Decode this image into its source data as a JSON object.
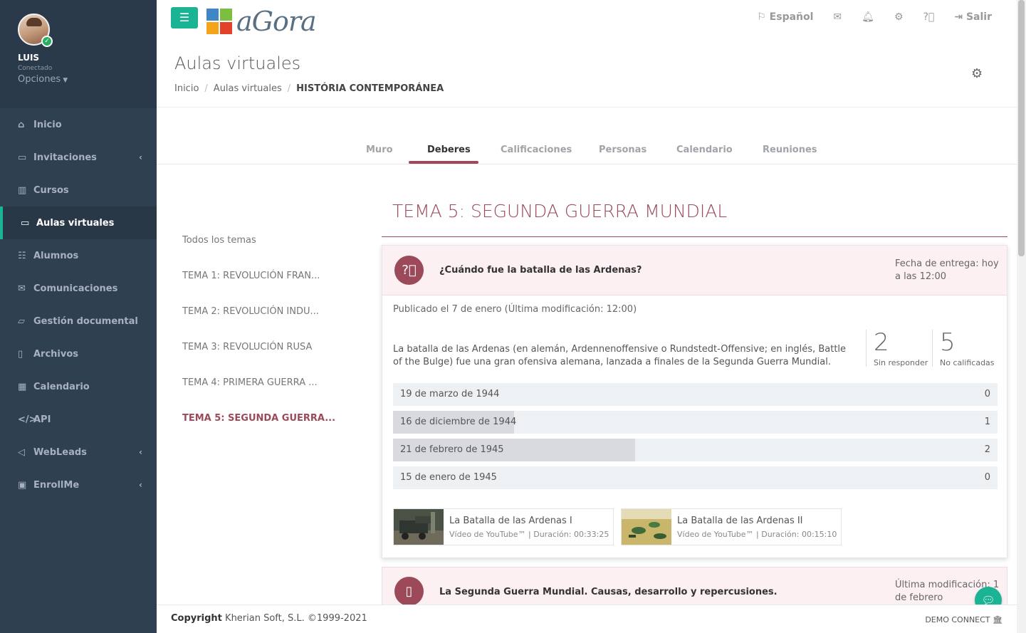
{
  "sidebar": {
    "user": {
      "name": "LUIS",
      "status": "Conectado",
      "options_label": "Opciones"
    },
    "items": [
      {
        "label": "Inicio",
        "icon": "home-icon",
        "glyph": "⌂",
        "has_arrow": false,
        "active": false
      },
      {
        "label": "Invitaciones",
        "icon": "ticket-icon",
        "glyph": "▭",
        "has_arrow": true,
        "active": false
      },
      {
        "label": "Cursos",
        "icon": "books-icon",
        "glyph": "▥",
        "has_arrow": false,
        "active": false
      },
      {
        "label": "Aulas virtuales",
        "icon": "laptop-icon",
        "glyph": "▭",
        "has_arrow": false,
        "active": true
      },
      {
        "label": "Alumnos",
        "icon": "students-icon",
        "glyph": "☷",
        "has_arrow": false,
        "active": false
      },
      {
        "label": "Comunicaciones",
        "icon": "envelope-icon",
        "glyph": "✉",
        "has_arrow": false,
        "active": false
      },
      {
        "label": "Gestión documental",
        "icon": "folder-icon",
        "glyph": "▱",
        "has_arrow": false,
        "active": false
      },
      {
        "label": "Archivos",
        "icon": "file-icon",
        "glyph": "▯",
        "has_arrow": false,
        "active": false
      },
      {
        "label": "Calendario",
        "icon": "calendar-icon",
        "glyph": "▦",
        "has_arrow": false,
        "active": false
      },
      {
        "label": "API",
        "icon": "code-icon",
        "glyph": "</>",
        "has_arrow": false,
        "active": false
      },
      {
        "label": "WebLeads",
        "icon": "paper-plane-icon",
        "glyph": "◁",
        "has_arrow": true,
        "active": false
      },
      {
        "label": "EnrollMe",
        "icon": "id-card-icon",
        "glyph": "▣",
        "has_arrow": true,
        "active": false
      }
    ],
    "arrow_glyph": "‹"
  },
  "topbar": {
    "menu_glyph": "☰",
    "logo_text": "aGora",
    "language": "Español",
    "salir": "Salir"
  },
  "header": {
    "title": "Aulas virtuales",
    "breadcrumb": [
      "Inicio",
      "Aulas virtuales",
      "HISTÓRIA CONTEMPORÁNEA"
    ]
  },
  "tabs": [
    "Muro",
    "Deberes",
    "Calificaciones",
    "Personas",
    "Calendario",
    "Reuniones"
  ],
  "active_tab": "Deberes",
  "topics": [
    {
      "label": "Todos los temas",
      "active": false
    },
    {
      "label": "TEMA 1: REVOLUCIÓN FRAN...",
      "active": false
    },
    {
      "label": "TEMA 2: REVOLUCIÓN INDU...",
      "active": false
    },
    {
      "label": "TEMA 3: REVOLUCIÓN RUSA",
      "active": false
    },
    {
      "label": "TEMA 4: PRIMERA GUERRA ...",
      "active": false
    },
    {
      "label": "TEMA 5: SEGUNDA GUERRA...",
      "active": true
    }
  ],
  "main": {
    "tema_title": "TEMA 5: SEGUNDA GUERRA MUNDIAL",
    "assignment": {
      "question": "¿Cuándo fue la batalla de las Ardenas?",
      "due": "Fecha de entrega: hoy a las 12:00",
      "published": "Publicado el 7 de enero (Última modificación: 12:00)",
      "description": "La batalla de las Ardenas (en alemán, Ardennenoffensive o Rundstedt-Offensive; en inglés, Battle of the Bulge) fue una gran ofensiva alemana, lanzada a finales de la Segunda Guerra Mundial.",
      "stats": [
        {
          "value": "2",
          "label": "Sin responder"
        },
        {
          "value": "5",
          "label": "No calificadas"
        }
      ],
      "options": [
        {
          "label": "19 de marzo de 1944",
          "count": 0,
          "fraction": 0
        },
        {
          "label": "16 de diciembre de 1944",
          "count": 1,
          "fraction": 0.2
        },
        {
          "label": "21 de febrero de 1945",
          "count": 2,
          "fraction": 0.4
        },
        {
          "label": "15 de enero de 1945",
          "count": 0,
          "fraction": 0
        }
      ],
      "videos": [
        {
          "title": "La Batalla de las Ardenas I",
          "meta": "Vídeo de YouTube™ | Duración: 00:33:25"
        },
        {
          "title": "La Batalla de las Ardenas II",
          "meta": "Vídeo de YouTube™ | Duración: 00:15:10"
        }
      ]
    },
    "second_item": {
      "title": "La Segunda Guerra Mundial. Causas, desarrollo y repercusiones.",
      "meta": "Última modificación: 1 de febrero"
    }
  },
  "footer": {
    "copyright_bold": "Copyright",
    "copyright_rest": " Kherian Soft, S.L. ©1999-2021",
    "demo": "DEMO CONNECT"
  },
  "colors": {
    "accent": "#1ab394",
    "brand": "#9c4a5a",
    "sidebar": "#2f4050"
  }
}
